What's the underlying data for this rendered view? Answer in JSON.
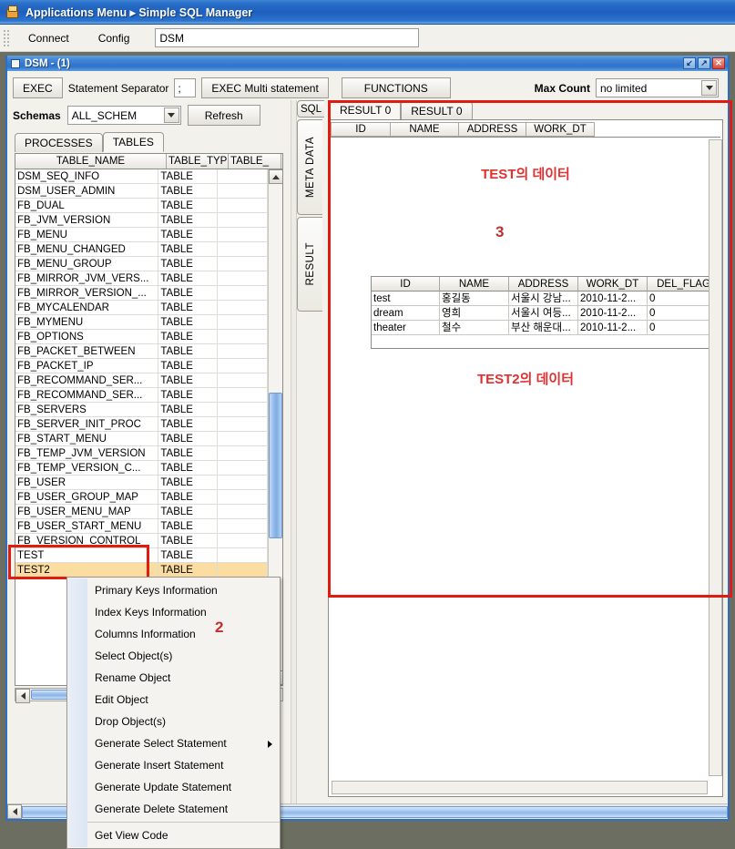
{
  "window": {
    "app_title": "Applications Menu ▸ Simple SQL Manager",
    "app_icon": "app-boxes-icon",
    "mdi_title": "DSM - (1)",
    "minimize_glyph": "↙",
    "maximize_glyph": "↗",
    "close_glyph": "✕"
  },
  "menubar": {
    "connect": "Connect",
    "config": "Config",
    "dsm_field_value": "DSM"
  },
  "toolbar": {
    "exec": "EXEC",
    "statement_separator_label": "Statement Separator",
    "statement_separator_value": ";",
    "exec_multi": "EXEC Multi statement",
    "functions": "FUNCTIONS",
    "max_count_label": "Max Count",
    "max_count_value": "no limited"
  },
  "left": {
    "schemas_label": "Schemas",
    "schemas_value": "ALL_SCHEM",
    "refresh": "Refresh",
    "tabs": [
      {
        "label": "PROCESSES",
        "active": false
      },
      {
        "label": "TABLES",
        "active": true
      }
    ],
    "columns": [
      "TABLE_NAME",
      "TABLE_TYPE",
      "TABLE_"
    ],
    "rows": [
      {
        "name": "DSM_SEQ_INFO",
        "type": "TABLE"
      },
      {
        "name": "DSM_USER_ADMIN",
        "type": "TABLE"
      },
      {
        "name": "FB_DUAL",
        "type": "TABLE"
      },
      {
        "name": "FB_JVM_VERSION",
        "type": "TABLE"
      },
      {
        "name": "FB_MENU",
        "type": "TABLE"
      },
      {
        "name": "FB_MENU_CHANGED",
        "type": "TABLE"
      },
      {
        "name": "FB_MENU_GROUP",
        "type": "TABLE"
      },
      {
        "name": "FB_MIRROR_JVM_VERS...",
        "type": "TABLE"
      },
      {
        "name": "FB_MIRROR_VERSION_...",
        "type": "TABLE"
      },
      {
        "name": "FB_MYCALENDAR",
        "type": "TABLE"
      },
      {
        "name": "FB_MYMENU",
        "type": "TABLE"
      },
      {
        "name": "FB_OPTIONS",
        "type": "TABLE"
      },
      {
        "name": "FB_PACKET_BETWEEN",
        "type": "TABLE"
      },
      {
        "name": "FB_PACKET_IP",
        "type": "TABLE"
      },
      {
        "name": "FB_RECOMMAND_SER...",
        "type": "TABLE"
      },
      {
        "name": "FB_RECOMMAND_SER...",
        "type": "TABLE"
      },
      {
        "name": "FB_SERVERS",
        "type": "TABLE"
      },
      {
        "name": "FB_SERVER_INIT_PROC",
        "type": "TABLE"
      },
      {
        "name": "FB_START_MENU",
        "type": "TABLE"
      },
      {
        "name": "FB_TEMP_JVM_VERSION",
        "type": "TABLE"
      },
      {
        "name": "FB_TEMP_VERSION_C...",
        "type": "TABLE"
      },
      {
        "name": "FB_USER",
        "type": "TABLE"
      },
      {
        "name": "FB_USER_GROUP_MAP",
        "type": "TABLE"
      },
      {
        "name": "FB_USER_MENU_MAP",
        "type": "TABLE"
      },
      {
        "name": "FB_USER_START_MENU",
        "type": "TABLE"
      },
      {
        "name": "FB_VERSION_CONTROL",
        "type": "TABLE"
      },
      {
        "name": "TEST",
        "type": "TABLE",
        "highlight": false
      },
      {
        "name": "TEST2",
        "type": "TABLE",
        "highlight": true
      }
    ]
  },
  "right": {
    "vertical_tabs": [
      {
        "label": "SQL"
      },
      {
        "label": "META DATA"
      },
      {
        "label": "RESULT"
      }
    ],
    "result_tabs": [
      {
        "label": "RESULT 0",
        "active": true
      },
      {
        "label": "RESULT 0",
        "active": false
      }
    ],
    "grid1": {
      "columns": [
        "ID",
        "NAME",
        "ADDRESS",
        "WORK_DT"
      ],
      "rows": []
    },
    "grid2": {
      "columns": [
        "ID",
        "NAME",
        "ADDRESS",
        "WORK_DT",
        "DEL_FLAG"
      ],
      "rows": [
        [
          "test",
          "홍길동",
          "서울시 강남...",
          "2010-11-2...",
          "0"
        ],
        [
          "dream",
          "영희",
          "서울시 여등...",
          "2010-11-2...",
          "0"
        ],
        [
          "theater",
          "철수",
          "부산 해운대...",
          "2010-11-2...",
          "0"
        ]
      ]
    },
    "annotations": {
      "test_data": "TEST의 데이터",
      "step3": "3",
      "test2_data": "TEST2의 데이터"
    }
  },
  "context_menu": {
    "step_marker": "2",
    "items": [
      {
        "label": "Primary Keys Information",
        "submenu": false,
        "sep_after": false,
        "boxed": false
      },
      {
        "label": "Index Keys Information",
        "submenu": false,
        "sep_after": false,
        "boxed": false
      },
      {
        "label": "Columns Information",
        "submenu": false,
        "sep_after": false,
        "boxed": false
      },
      {
        "label": "Select Object(s)",
        "submenu": false,
        "sep_after": false,
        "boxed": true
      },
      {
        "label": "Rename Object",
        "submenu": false,
        "sep_after": false,
        "boxed": false
      },
      {
        "label": "Edit Object",
        "submenu": false,
        "sep_after": false,
        "boxed": false
      },
      {
        "label": "Drop Object(s)",
        "submenu": false,
        "sep_after": false,
        "boxed": false
      },
      {
        "label": "Generate Select Statement",
        "submenu": true,
        "sep_after": false,
        "boxed": false
      },
      {
        "label": "Generate Insert Statement",
        "submenu": false,
        "sep_after": false,
        "boxed": false
      },
      {
        "label": "Generate Update Statement",
        "submenu": false,
        "sep_after": false,
        "boxed": false
      },
      {
        "label": "Generate Delete Statement",
        "submenu": false,
        "sep_after": true,
        "boxed": false
      },
      {
        "label": "Get View Code",
        "submenu": false,
        "sep_after": false,
        "boxed": false
      }
    ]
  },
  "colors": {
    "annotation_red": "#e01b10",
    "selection_orange": "#fcdda1",
    "titlebar_blue": "#2a6fc8",
    "desktop_gray": "#6b6e61"
  }
}
